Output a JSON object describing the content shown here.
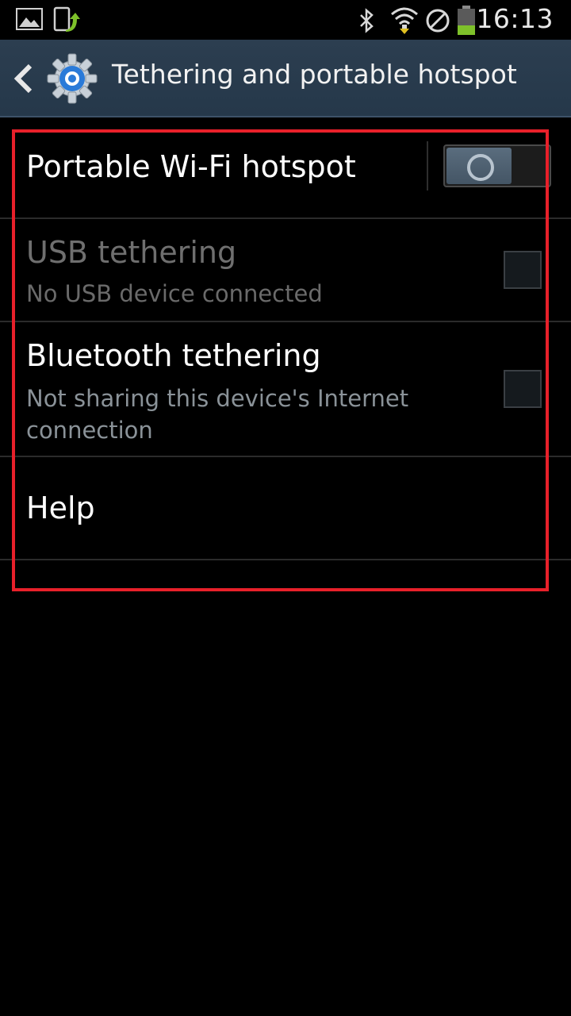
{
  "status_bar": {
    "time": "16:13",
    "left_icons": [
      "gallery-icon",
      "phone-upload-icon"
    ],
    "right_icons": [
      "bluetooth-icon",
      "wifi-icon",
      "no-sim-icon",
      "battery-icon"
    ],
    "battery_level": 0.35,
    "battery_color": "#7ec12a"
  },
  "action_bar": {
    "title": "Tethering and portable hotspot",
    "back_icon": "chevron-left-icon",
    "app_icon": "settings-gear-icon"
  },
  "settings": {
    "hotspot": {
      "title": "Portable Wi-Fi hotspot",
      "enabled": false
    },
    "usb": {
      "title": "USB tethering",
      "summary": "No USB device connected",
      "checked": false,
      "disabled": true
    },
    "bluetooth": {
      "title": "Bluetooth tethering",
      "summary": "Not sharing this device's Internet connection",
      "checked": false
    },
    "help": {
      "title": "Help"
    }
  },
  "colors": {
    "highlight": "#e8202a",
    "action_bar": "#2c3e50"
  }
}
